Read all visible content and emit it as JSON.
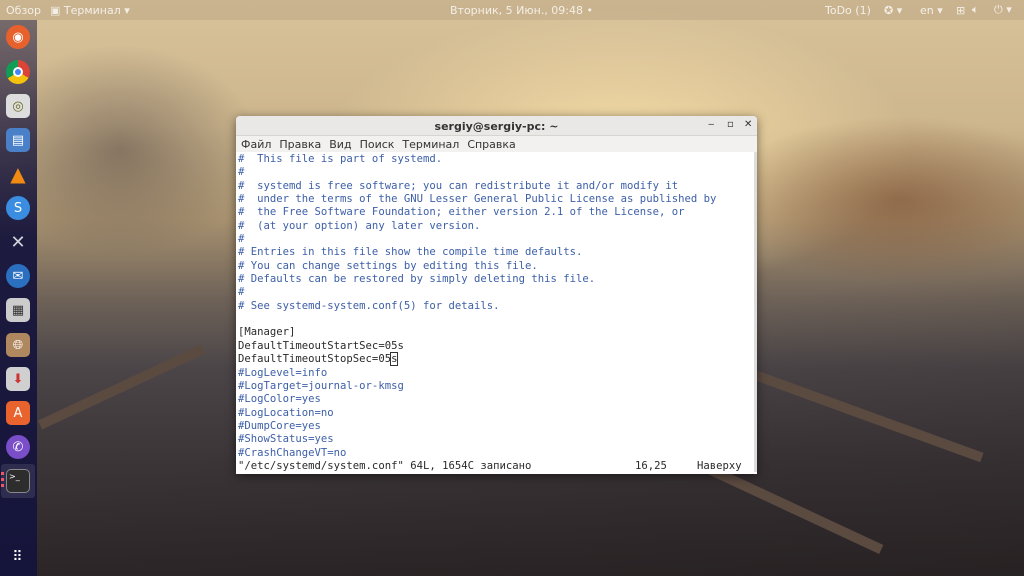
{
  "topbar": {
    "activities": "Обзор",
    "app_menu": "Терминал",
    "clock": "Вторник, 5 Июн., 09:48",
    "todo": "ToDo (1)",
    "language": "en"
  },
  "dock": {
    "items": [
      "firefox",
      "chrome",
      "rhythmbox",
      "files-cabinet",
      "vlc",
      "simplenote",
      "system-tools",
      "thunderbird",
      "calculator",
      "archive-manager",
      "installer",
      "software-center",
      "viber",
      "terminal"
    ],
    "show_apps": "apps-grid"
  },
  "window": {
    "title": "sergiy@sergiy-pc: ~",
    "menu": [
      "Файл",
      "Правка",
      "Вид",
      "Поиск",
      "Терминал",
      "Справка"
    ]
  },
  "editor": {
    "lines": [
      {
        "t": "#  This file is part of systemd.",
        "c": true
      },
      {
        "t": "#",
        "c": true
      },
      {
        "t": "#  systemd is free software; you can redistribute it and/or modify it",
        "c": true
      },
      {
        "t": "#  under the terms of the GNU Lesser General Public License as published by",
        "c": true
      },
      {
        "t": "#  the Free Software Foundation; either version 2.1 of the License, or",
        "c": true
      },
      {
        "t": "#  (at your option) any later version.",
        "c": true
      },
      {
        "t": "#",
        "c": true
      },
      {
        "t": "# Entries in this file show the compile time defaults.",
        "c": true
      },
      {
        "t": "# You can change settings by editing this file.",
        "c": true
      },
      {
        "t": "# Defaults can be restored by simply deleting this file.",
        "c": true
      },
      {
        "t": "#",
        "c": true
      },
      {
        "t": "# See systemd-system.conf(5) for details.",
        "c": true
      },
      {
        "t": "",
        "c": false
      },
      {
        "t": "[Manager]",
        "c": false
      },
      {
        "t": "DefaultTimeoutStartSec=05s",
        "c": false
      },
      {
        "t": "DefaultTimeoutStopSec=05",
        "c": false,
        "cursor": "s"
      },
      {
        "t": "#LogLevel=info",
        "c": true
      },
      {
        "t": "#LogTarget=journal-or-kmsg",
        "c": true
      },
      {
        "t": "#LogColor=yes",
        "c": true
      },
      {
        "t": "#LogLocation=no",
        "c": true
      },
      {
        "t": "#DumpCore=yes",
        "c": true
      },
      {
        "t": "#ShowStatus=yes",
        "c": true
      },
      {
        "t": "#CrashChangeVT=no",
        "c": true
      }
    ],
    "status_msg": "\"/etc/systemd/system.conf\" 64L, 1654C записано",
    "position": "16,25",
    "scroll": "Наверху"
  }
}
